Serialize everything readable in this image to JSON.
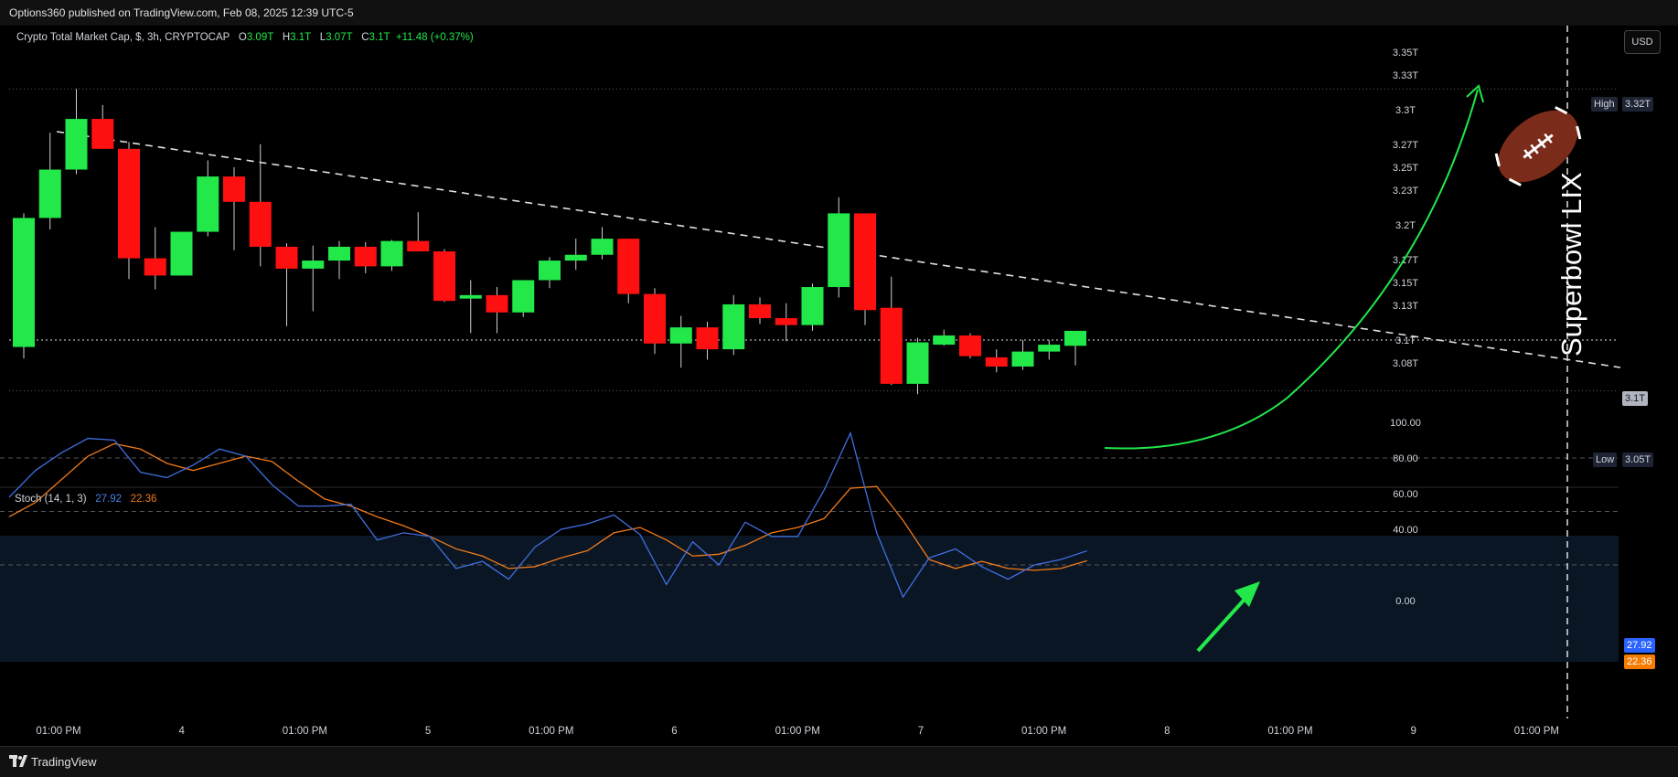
{
  "header": {
    "publisher": "Options360 published on TradingView.com, Feb 08, 2025 12:39 UTC-5"
  },
  "footer": {
    "brand": "TradingView"
  },
  "legend": {
    "symbol": "Crypto Total Market Cap, $, 3h, CRYPTOCAP",
    "o_label": "O",
    "o_value": "3.09T",
    "h_label": "H",
    "h_value": "3.1T",
    "l_label": "L",
    "l_value": "3.07T",
    "c_label": "C",
    "c_value": "3.1T",
    "change": "+11.48 (+0.37%)"
  },
  "stoch_legend": {
    "name": "Stoch (14, 1, 3)",
    "k": "27.92",
    "d": "22.36"
  },
  "currency_button": "USD",
  "tags": {
    "high_name": "High",
    "high_value": "3.32T",
    "low_name": "Low",
    "low_value": "3.05T",
    "last_value": "3.1T",
    "k_value": "27.92",
    "d_value": "22.36"
  },
  "annotation": {
    "event_text": "Superbowl LIX",
    "icon": "football-icon"
  },
  "colors": {
    "up": "#22e84a",
    "down": "#ff1010",
    "stoch_k": "#3f6fe0",
    "stoch_d": "#f07a1a",
    "arrow": "#22e84a",
    "trendline": "#e0e0e0"
  },
  "chart_data": [
    {
      "type": "candlestick",
      "title": "Crypto Total Market Cap, $, 3h, CRYPTOCAP",
      "ylim": [
        3.03,
        3.37
      ],
      "y_ticks": [
        "3.35T",
        "3.33T",
        "3.3T",
        "3.27T",
        "3.25T",
        "3.23T",
        "3.2T",
        "3.17T",
        "3.15T",
        "3.13T",
        "3.1T",
        "3.08T"
      ],
      "x_ticks": [
        "01:00 PM",
        "4",
        "01:00 PM",
        "5",
        "01:00 PM",
        "6",
        "01:00 PM",
        "7",
        "01:00 PM",
        "8",
        "01:00 PM",
        "9",
        "01:00 PM"
      ],
      "ohlc": [
        [
          3.094,
          3.21,
          3.084,
          3.206
        ],
        [
          3.206,
          3.28,
          3.196,
          3.248
        ],
        [
          3.248,
          3.318,
          3.244,
          3.292
        ],
        [
          3.292,
          3.304,
          3.266,
          3.266
        ],
        [
          3.266,
          3.272,
          3.153,
          3.171
        ],
        [
          3.171,
          3.198,
          3.144,
          3.156
        ],
        [
          3.156,
          3.192,
          3.156,
          3.194
        ],
        [
          3.194,
          3.256,
          3.19,
          3.242
        ],
        [
          3.242,
          3.25,
          3.178,
          3.22
        ],
        [
          3.22,
          3.27,
          3.164,
          3.181
        ],
        [
          3.181,
          3.184,
          3.112,
          3.162
        ],
        [
          3.162,
          3.182,
          3.125,
          3.169
        ],
        [
          3.169,
          3.186,
          3.153,
          3.181
        ],
        [
          3.181,
          3.185,
          3.158,
          3.164
        ],
        [
          3.164,
          3.187,
          3.16,
          3.186
        ],
        [
          3.186,
          3.211,
          3.18,
          3.177
        ],
        [
          3.177,
          3.179,
          3.133,
          3.134
        ],
        [
          3.136,
          3.152,
          3.106,
          3.139
        ],
        [
          3.139,
          3.146,
          3.106,
          3.124
        ],
        [
          3.124,
          3.152,
          3.12,
          3.152
        ],
        [
          3.152,
          3.172,
          3.145,
          3.169
        ],
        [
          3.169,
          3.188,
          3.161,
          3.174
        ],
        [
          3.174,
          3.198,
          3.17,
          3.188
        ],
        [
          3.188,
          3.186,
          3.132,
          3.14
        ],
        [
          3.14,
          3.145,
          3.088,
          3.097
        ],
        [
          3.097,
          3.121,
          3.076,
          3.111
        ],
        [
          3.111,
          3.116,
          3.083,
          3.092
        ],
        [
          3.092,
          3.139,
          3.087,
          3.131
        ],
        [
          3.131,
          3.137,
          3.114,
          3.119
        ],
        [
          3.119,
          3.132,
          3.099,
          3.113
        ],
        [
          3.113,
          3.149,
          3.108,
          3.146
        ],
        [
          3.146,
          3.224,
          3.137,
          3.21
        ],
        [
          3.21,
          3.21,
          3.113,
          3.126
        ],
        [
          3.128,
          3.155,
          3.061,
          3.062
        ],
        [
          3.062,
          3.102,
          3.053,
          3.098
        ],
        [
          3.096,
          3.109,
          3.095,
          3.104
        ],
        [
          3.104,
          3.106,
          3.084,
          3.086
        ],
        [
          3.085,
          3.092,
          3.072,
          3.077
        ],
        [
          3.077,
          3.1,
          3.074,
          3.09
        ],
        [
          3.09,
          3.1,
          3.083,
          3.096
        ],
        [
          3.095,
          3.103,
          3.078,
          3.108
        ]
      ],
      "high": "3.32T",
      "low": "3.05T",
      "last": "3.1T"
    },
    {
      "type": "line",
      "title": "Stoch (14, 1, 3)",
      "ylim": [
        0,
        100
      ],
      "y_ticks": [
        "100.00",
        "80.00",
        "60.00",
        "40.00",
        "0.00"
      ],
      "bands": [
        20,
        50,
        80
      ],
      "series": [
        {
          "name": "%K",
          "values": [
            58,
            73,
            83,
            91,
            90,
            72,
            69,
            76,
            85,
            81,
            65,
            53,
            53,
            54,
            34,
            38,
            36,
            18,
            22,
            12,
            30,
            40,
            43,
            48,
            37,
            9,
            33,
            20,
            44,
            36,
            36,
            62,
            94,
            38,
            2,
            24,
            29,
            19,
            12,
            20,
            23,
            27.92
          ]
        },
        {
          "name": "%D",
          "values": [
            47,
            55,
            68,
            81,
            88,
            85,
            77,
            73,
            77,
            81,
            78,
            67,
            57,
            53,
            47,
            42,
            36,
            29,
            25,
            18,
            19,
            24,
            28,
            38,
            41,
            34,
            25,
            26,
            31,
            38,
            41,
            46,
            63,
            64,
            45,
            23,
            18,
            22,
            18,
            17,
            18,
            22.36
          ]
        }
      ]
    }
  ]
}
